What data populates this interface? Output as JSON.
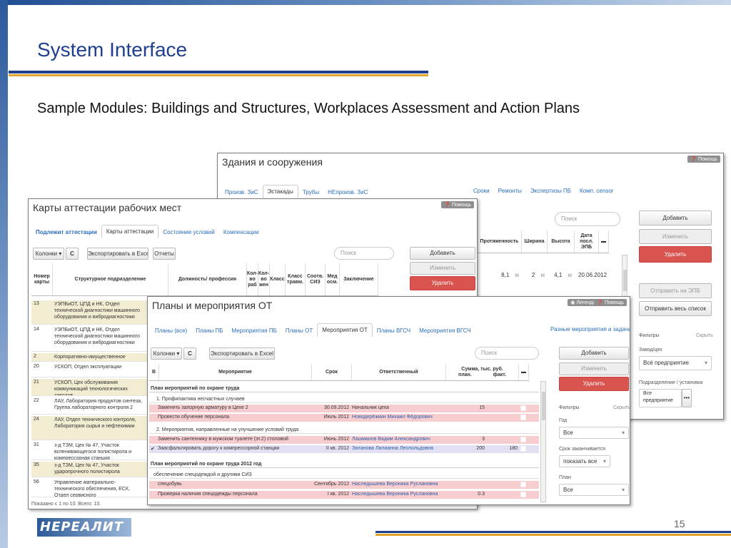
{
  "slide": {
    "title": "System Interface",
    "subtitle": "Sample Modules: Buildings and Structures, Workplaces Assessment and Action Plans",
    "page_number": "15",
    "logo_text": "НЕРЕАЛИТ",
    "colors": {
      "title_blue": "#1f3f8f",
      "accent_gold": "#e2a52b",
      "delete_red": "#d9534f",
      "link_blue": "#2a6ebb"
    }
  },
  "buildings": {
    "title": "Здания и сооружения",
    "help": "Помощь",
    "tabs_left": [
      "Произв. ЗиС",
      "Эстакады",
      "Трубы",
      "НЕпроизв. ЗиС"
    ],
    "active_tab": "Эстакады",
    "tabs_right": [
      "Сроки",
      "Ремонты",
      "Экспертизы ПБ",
      "Комп. censor"
    ],
    "search_placeholder": "Поиск",
    "columns": [
      "Протяженность",
      "Ширина",
      "Высота",
      "Дата посл. ЭПБ"
    ],
    "row": {
      "length": "8,1",
      "length_unit": "м",
      "width": "2",
      "width_unit": "м",
      "height": "4,1",
      "height_unit": "м",
      "date": "20.06.2012"
    },
    "buttons": {
      "add": "Добавить",
      "edit": "Изменить",
      "delete": "Удалить",
      "send_epb": "Отправить на ЭПБ",
      "send_all": "Отправить весь список"
    },
    "filters": {
      "label": "Фильтры",
      "hide": "Скрыть",
      "plant_label": "Завод/цех",
      "plant_value": "Всё предприятие",
      "unit_label": "Подразделение / установка",
      "unit_value": "Все предприятие",
      "more": "•••"
    }
  },
  "attestation": {
    "title": "Карты аттестации рабочих мест",
    "help": "Помощь",
    "tabs": [
      "Подлежит аттестации",
      "Карты аттестации",
      "Состояние условий",
      "Компенсации"
    ],
    "active_tab": "Карты аттестации",
    "toolbar": {
      "columns": "Колонки",
      "refresh": "C",
      "export": "Экспортировать в Excel",
      "reports": "Отчеты"
    },
    "search_placeholder": "Поиск",
    "buttons": {
      "add": "Добавить",
      "edit": "Изменить",
      "delete": "Удалить"
    },
    "columns": [
      "Номер карты",
      "Структурное подразделение",
      "Должность/ профессия",
      "Кол-во раб",
      "Кол-во жен",
      "Класс",
      "Класс травм.",
      "Соотв. СИЗ",
      "Мед осм.",
      "Заключение"
    ],
    "rows": [
      {
        "num": "13",
        "dept": "УЭПБиОТ, ЦПД и НК, Отдел технической диагностики машинного оборудования и вибродиагностики"
      },
      {
        "num": "14",
        "dept": "УЭПБиОТ, ЦПД и НК, Отдел технической диагностики машинного оборудования и вибродиагностики"
      },
      {
        "num": "2",
        "dept": "Корпоративно-имущественное управление"
      },
      {
        "num": "20",
        "dept": "УСКОП, Отдел эксплуатации"
      },
      {
        "num": "21",
        "dept": "УСКОП, Цех обслуживания коммуникаций технологических заводов"
      },
      {
        "num": "22",
        "dept": "ЛАУ, Лаборатория продуктов синтеза, Группа лабораторного контроля 2"
      },
      {
        "num": "24",
        "dept": "ЛАУ, Отдел технического контроля, Лаборатория сырья и нефтехимии"
      },
      {
        "num": "31",
        "dept": "з-д ТЗМ, Цех № 47, Участок вспенивающегося полистирола и компрессорная станция"
      },
      {
        "num": "35",
        "dept": "з-д ТЗМ, Цех № 47, Участок ударопрочного полистирола"
      },
      {
        "num": "56",
        "dept": "Управление материально-технического обеспечения, ЕСК, Отдел сервисного"
      }
    ],
    "footer": "Показано с 1 по 10. Всего: 10."
  },
  "plans": {
    "title": "Планы и мероприятия ОТ",
    "legend": "Легенда",
    "help": "Помощь",
    "tabs": [
      "Планы (все)",
      "Планы ПБ",
      "Мероприятия ПБ",
      "Планы ОТ",
      "Мероприятия ОТ",
      "Планы ВГСЧ",
      "Мероприятия ВГСЧ"
    ],
    "active_tab": "Мероприятия ОТ",
    "tab_right": "Разные мероприятия и задачи",
    "toolbar": {
      "columns": "Колонки",
      "refresh": "C",
      "export": "Экспортировать в Excel"
    },
    "search_placeholder": "Поиск",
    "buttons": {
      "add": "Добавить",
      "edit": "Изменить",
      "delete": "Удалить"
    },
    "columns": {
      "b": "В",
      "measure": "Мероприятие",
      "due": "Срок",
      "responsible": "Ответственный",
      "sum": "Сумма, тыс. руб.",
      "planned": "план.",
      "actual": "факт."
    },
    "groups": [
      {
        "title": "План мероприятий по охране труда",
        "sections": [
          {
            "title": "1. Профилактика несчастных случаев",
            "rows": [
              {
                "mark": "",
                "name": "Заменить запорную арматуру в Цехе 2",
                "due": "30.09.2012",
                "resp": "Начальник цеха",
                "plan": "15",
                "fact": "",
                "color": "pink",
                "resp_link": false
              },
              {
                "mark": "",
                "name": "Провести обучение персонала",
                "due": "Июль 2012",
                "resp": "Новодерёжкин Михаил Фёдорович",
                "plan": "",
                "fact": "",
                "color": "pink",
                "resp_link": true
              }
            ]
          },
          {
            "title": "2. Мероприятия, направленные на улучшение условий труда",
            "rows": [
              {
                "mark": "",
                "name": "Заменить сантехнику в мужском туалете (эт.2) столовой",
                "due": "Июнь 2012",
                "resp": "Лашманов Вадим Александрович",
                "plan": "3",
                "fact": "",
                "color": "pink",
                "resp_link": true
              },
              {
                "mark": "✔",
                "name": "Заасфальтировать дорогу к компрессорной станции",
                "due": "II кв. 2012",
                "resp": "Зюганова Лилианна Леопольдовна",
                "plan": "200",
                "fact": "180",
                "color": "lav",
                "resp_link": true
              }
            ]
          }
        ]
      },
      {
        "title": "План мероприятий по охране труда 2012 год",
        "sections": [
          {
            "title": "обеспечение спецодеждой и другими СИЗ",
            "rows": [
              {
                "mark": "",
                "name": "спецобувь",
                "due": "Сентябрь 2012",
                "resp": "Наследышева Вероника Руслановна",
                "plan": "",
                "fact": "",
                "color": "pink",
                "resp_link": true
              },
              {
                "mark": "",
                "name": "Проверка наличия спецодежды персонала",
                "due": "I кв. 2012",
                "resp": "Наследышева Вероника Руслановна",
                "plan": "0.3",
                "fact": "",
                "color": "pink",
                "resp_link": true
              }
            ]
          }
        ]
      }
    ],
    "filters": {
      "label": "Фильтры",
      "hide": "Скрыть",
      "year_label": "Год",
      "year_value": "Все",
      "deadline_label": "Срок заканчивается",
      "deadline_value": "показать все",
      "plan_label": "План",
      "plan_value": "Все"
    }
  }
}
